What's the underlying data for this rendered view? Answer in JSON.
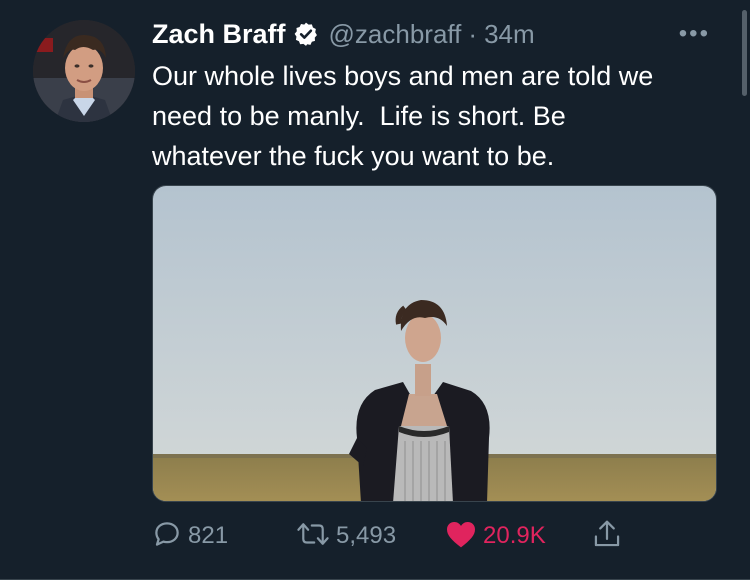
{
  "tweet": {
    "author_name": "Zach Braff",
    "handle": "@zachbraff",
    "separator": "·",
    "time": "34m",
    "more_label": "•••",
    "text_lines": [
      "Our whole lives boys and men are told we",
      "need to be manly.  Life is short. Be",
      "whatever the fuck you want to be."
    ],
    "verified": true
  },
  "actions": {
    "reply_count": "821",
    "retweet_count": "5,493",
    "like_count": "20.9K",
    "liked": true
  },
  "icons": {
    "verified": "verified-badge-icon",
    "more": "more-options-icon",
    "reply": "reply-icon",
    "retweet": "retweet-icon",
    "like": "heart-icon",
    "share": "share-icon"
  },
  "colors": {
    "background": "#15202b",
    "secondary_text": "#8899a6",
    "like": "#e0245e",
    "border": "#38444d"
  }
}
